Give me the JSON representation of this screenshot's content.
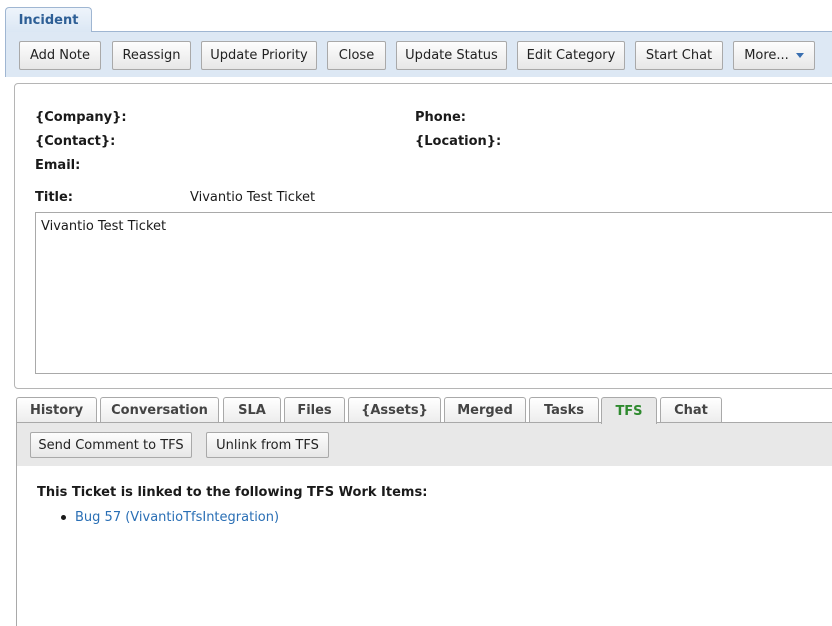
{
  "top_tab": {
    "label": "Incident"
  },
  "toolbar": {
    "buttons": [
      {
        "label": "Add Note"
      },
      {
        "label": "Reassign"
      },
      {
        "label": "Update Priority"
      },
      {
        "label": "Close"
      },
      {
        "label": "Update Status"
      },
      {
        "label": "Edit Category"
      },
      {
        "label": "Start Chat"
      },
      {
        "label": "More..."
      }
    ]
  },
  "details": {
    "company_label": "{Company}:",
    "contact_label": "{Contact}:",
    "email_label": "Email:",
    "phone_label": "Phone:",
    "location_label": "{Location}:",
    "title_label": "Title:",
    "title_value": "Vivantio Test Ticket",
    "description": "Vivantio Test Ticket"
  },
  "tabs": [
    {
      "label": "History"
    },
    {
      "label": "Conversation"
    },
    {
      "label": "SLA"
    },
    {
      "label": "Files"
    },
    {
      "label": "{Assets}"
    },
    {
      "label": "Merged"
    },
    {
      "label": "Tasks"
    },
    {
      "label": "TFS",
      "active": true
    },
    {
      "label": "Chat"
    }
  ],
  "tfs": {
    "send_label": "Send Comment to TFS",
    "unlink_label": "Unlink from TFS",
    "heading": "This Ticket is linked to the following TFS Work Items:",
    "work_items": [
      {
        "label": "Bug 57 (VivantioTfsIntegration)"
      }
    ]
  },
  "colors": {
    "accent": "#2e5f96",
    "active_tab_text": "#2f8a2f",
    "link": "#2a6fb5"
  }
}
